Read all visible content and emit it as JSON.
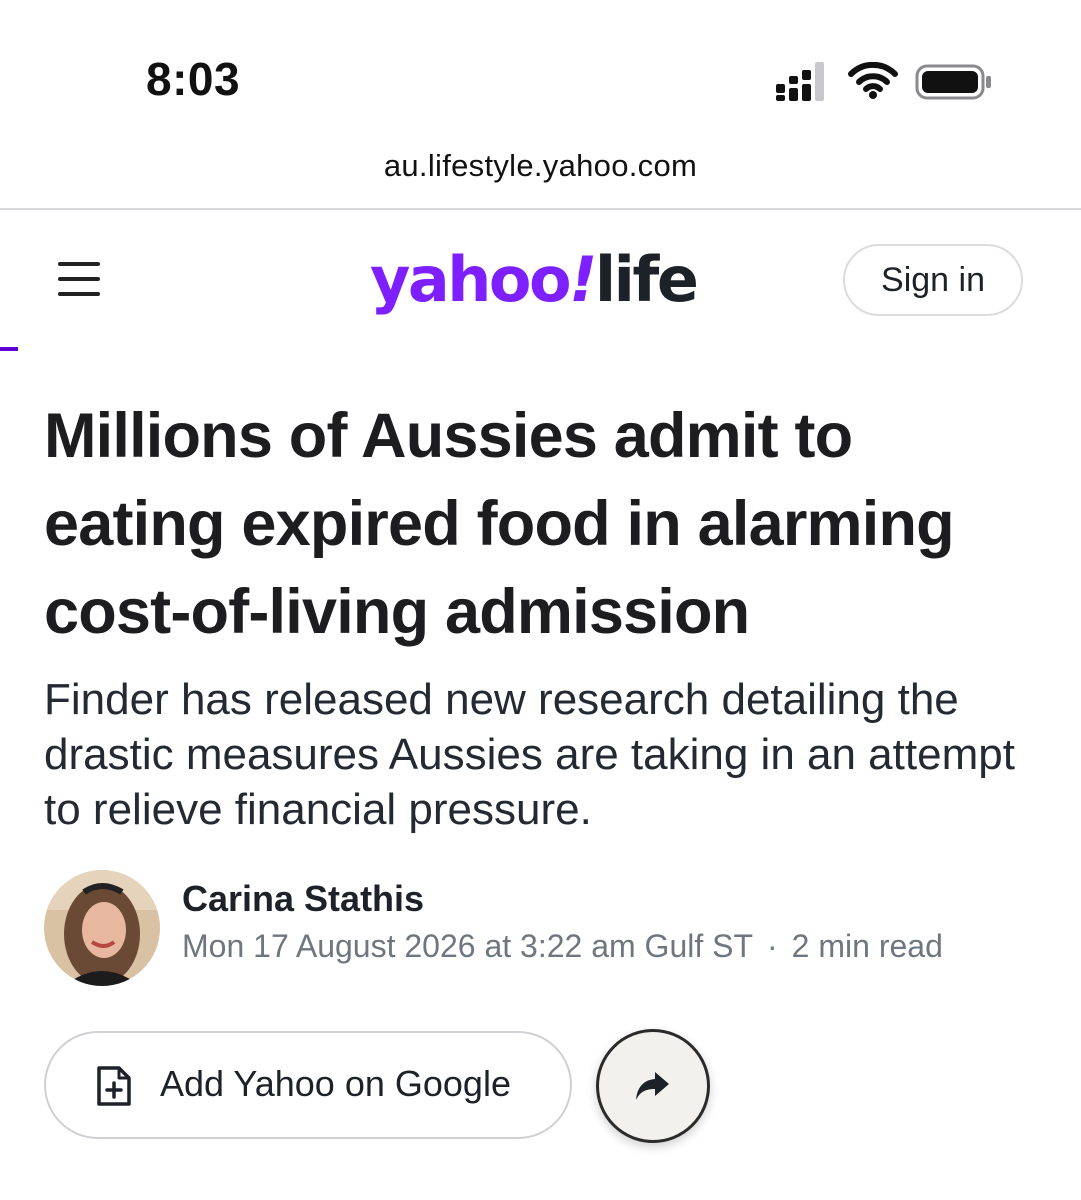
{
  "status_bar": {
    "time": "8:03"
  },
  "browser": {
    "url": "au.lifestyle.yahoo.com"
  },
  "header": {
    "logo_yahoo": "yahoo",
    "logo_bang": "!",
    "logo_life": "life",
    "signin_label": "Sign in"
  },
  "article": {
    "headline": "Millions of Aussies admit to eating expired food in alarming cost-of-living admission",
    "summary": "Finder has released new research detailing the drastic measures Aussies are taking in an attempt to relieve financial pressure.",
    "author": "Carina Stathis",
    "date": "Mon 17 August 2026 at 3:22 am Gulf ST",
    "separator": "·",
    "read_time": "2 min read"
  },
  "actions": {
    "add_google_label": "Add Yahoo on Google"
  },
  "colors": {
    "brand_purple": "#7e1fff",
    "text_dark": "#1d2228",
    "meta_gray": "#6e7780"
  },
  "icons": {
    "signal": "cellular-signal-icon",
    "wifi": "wifi-icon",
    "battery": "battery-icon",
    "menu": "hamburger-menu-icon",
    "add_doc": "document-plus-icon",
    "share": "share-arrow-icon"
  }
}
